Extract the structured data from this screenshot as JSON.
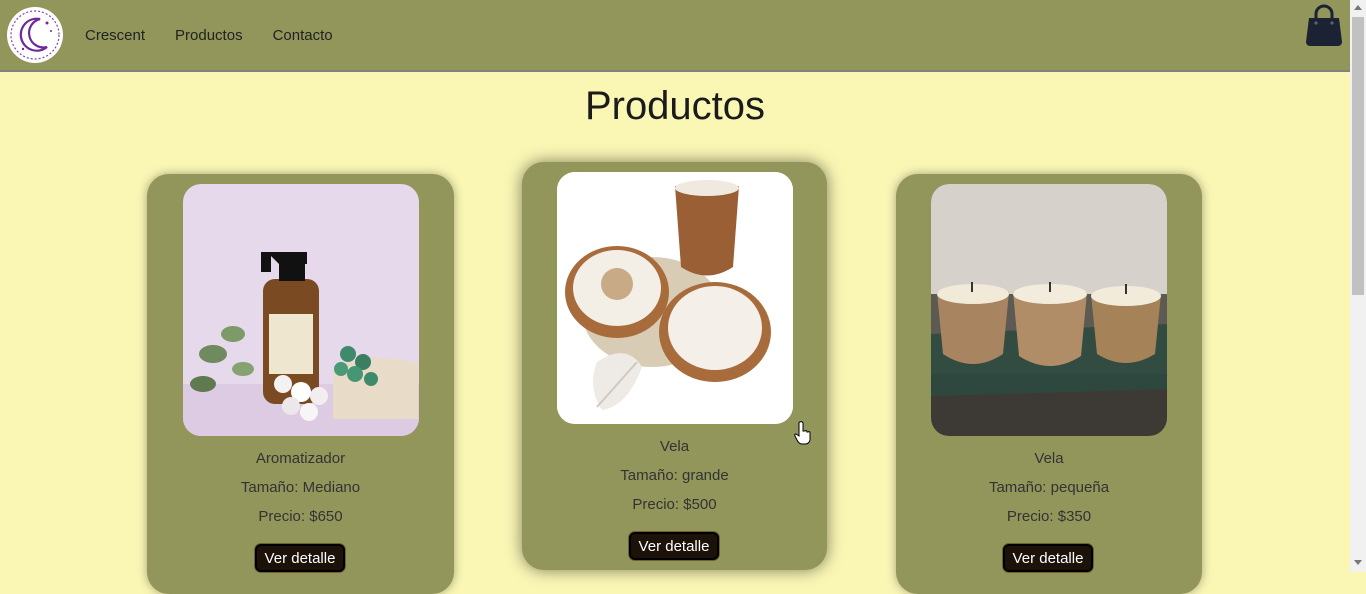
{
  "navbar": {
    "links": [
      "Crescent",
      "Productos",
      "Contacto"
    ],
    "logo_icon": "crescent-moon-logo-icon",
    "cart_icon": "shopping-bag-icon"
  },
  "page": {
    "title": "Productos"
  },
  "products": [
    {
      "name": "Aromatizador",
      "size": "Tamaño: Mediano",
      "price": "Precio: $650",
      "button": "Ver detalle",
      "image": "room-spray-bottle-with-stones"
    },
    {
      "name": "Vela",
      "size": "Tamaño: grande",
      "price": "Precio: $500",
      "button": "Ver detalle",
      "image": "wooden-bowl-candles"
    },
    {
      "name": "Vela",
      "size": "Tamaño: pequeña",
      "price": "Precio: $350",
      "button": "Ver detalle",
      "image": "three-wooden-cup-candles"
    }
  ],
  "colors": {
    "background": "#faf7b5",
    "navbar": "#92965b",
    "card": "#92965b",
    "button": "#1c1209"
  }
}
